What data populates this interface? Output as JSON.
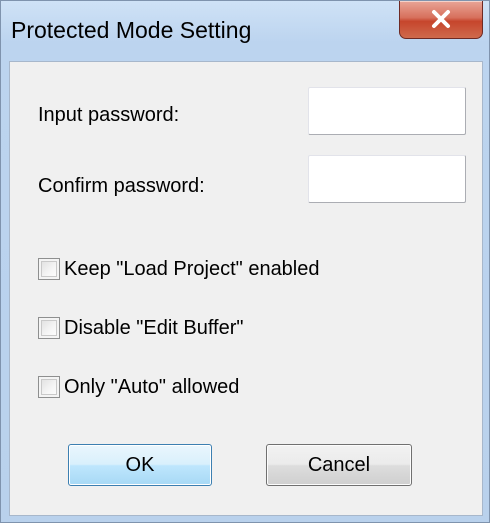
{
  "window": {
    "title": "Protected Mode Setting",
    "close_icon": "close-x-icon"
  },
  "form": {
    "input_password_label": "Input password:",
    "input_password_value": "",
    "confirm_password_label": "Confirm password:",
    "confirm_password_value": ""
  },
  "options": [
    {
      "label": "Keep \"Load Project\" enabled",
      "checked": false
    },
    {
      "label": "Disable \"Edit Buffer\"",
      "checked": false
    },
    {
      "label": "Only \"Auto\" allowed",
      "checked": false
    }
  ],
  "buttons": {
    "ok_label": "OK",
    "cancel_label": "Cancel"
  },
  "colors": {
    "frame": "#b9d1ec",
    "client": "#f0f0f0",
    "close_button": "#c6452c",
    "ok_border": "#3c7fb1"
  }
}
